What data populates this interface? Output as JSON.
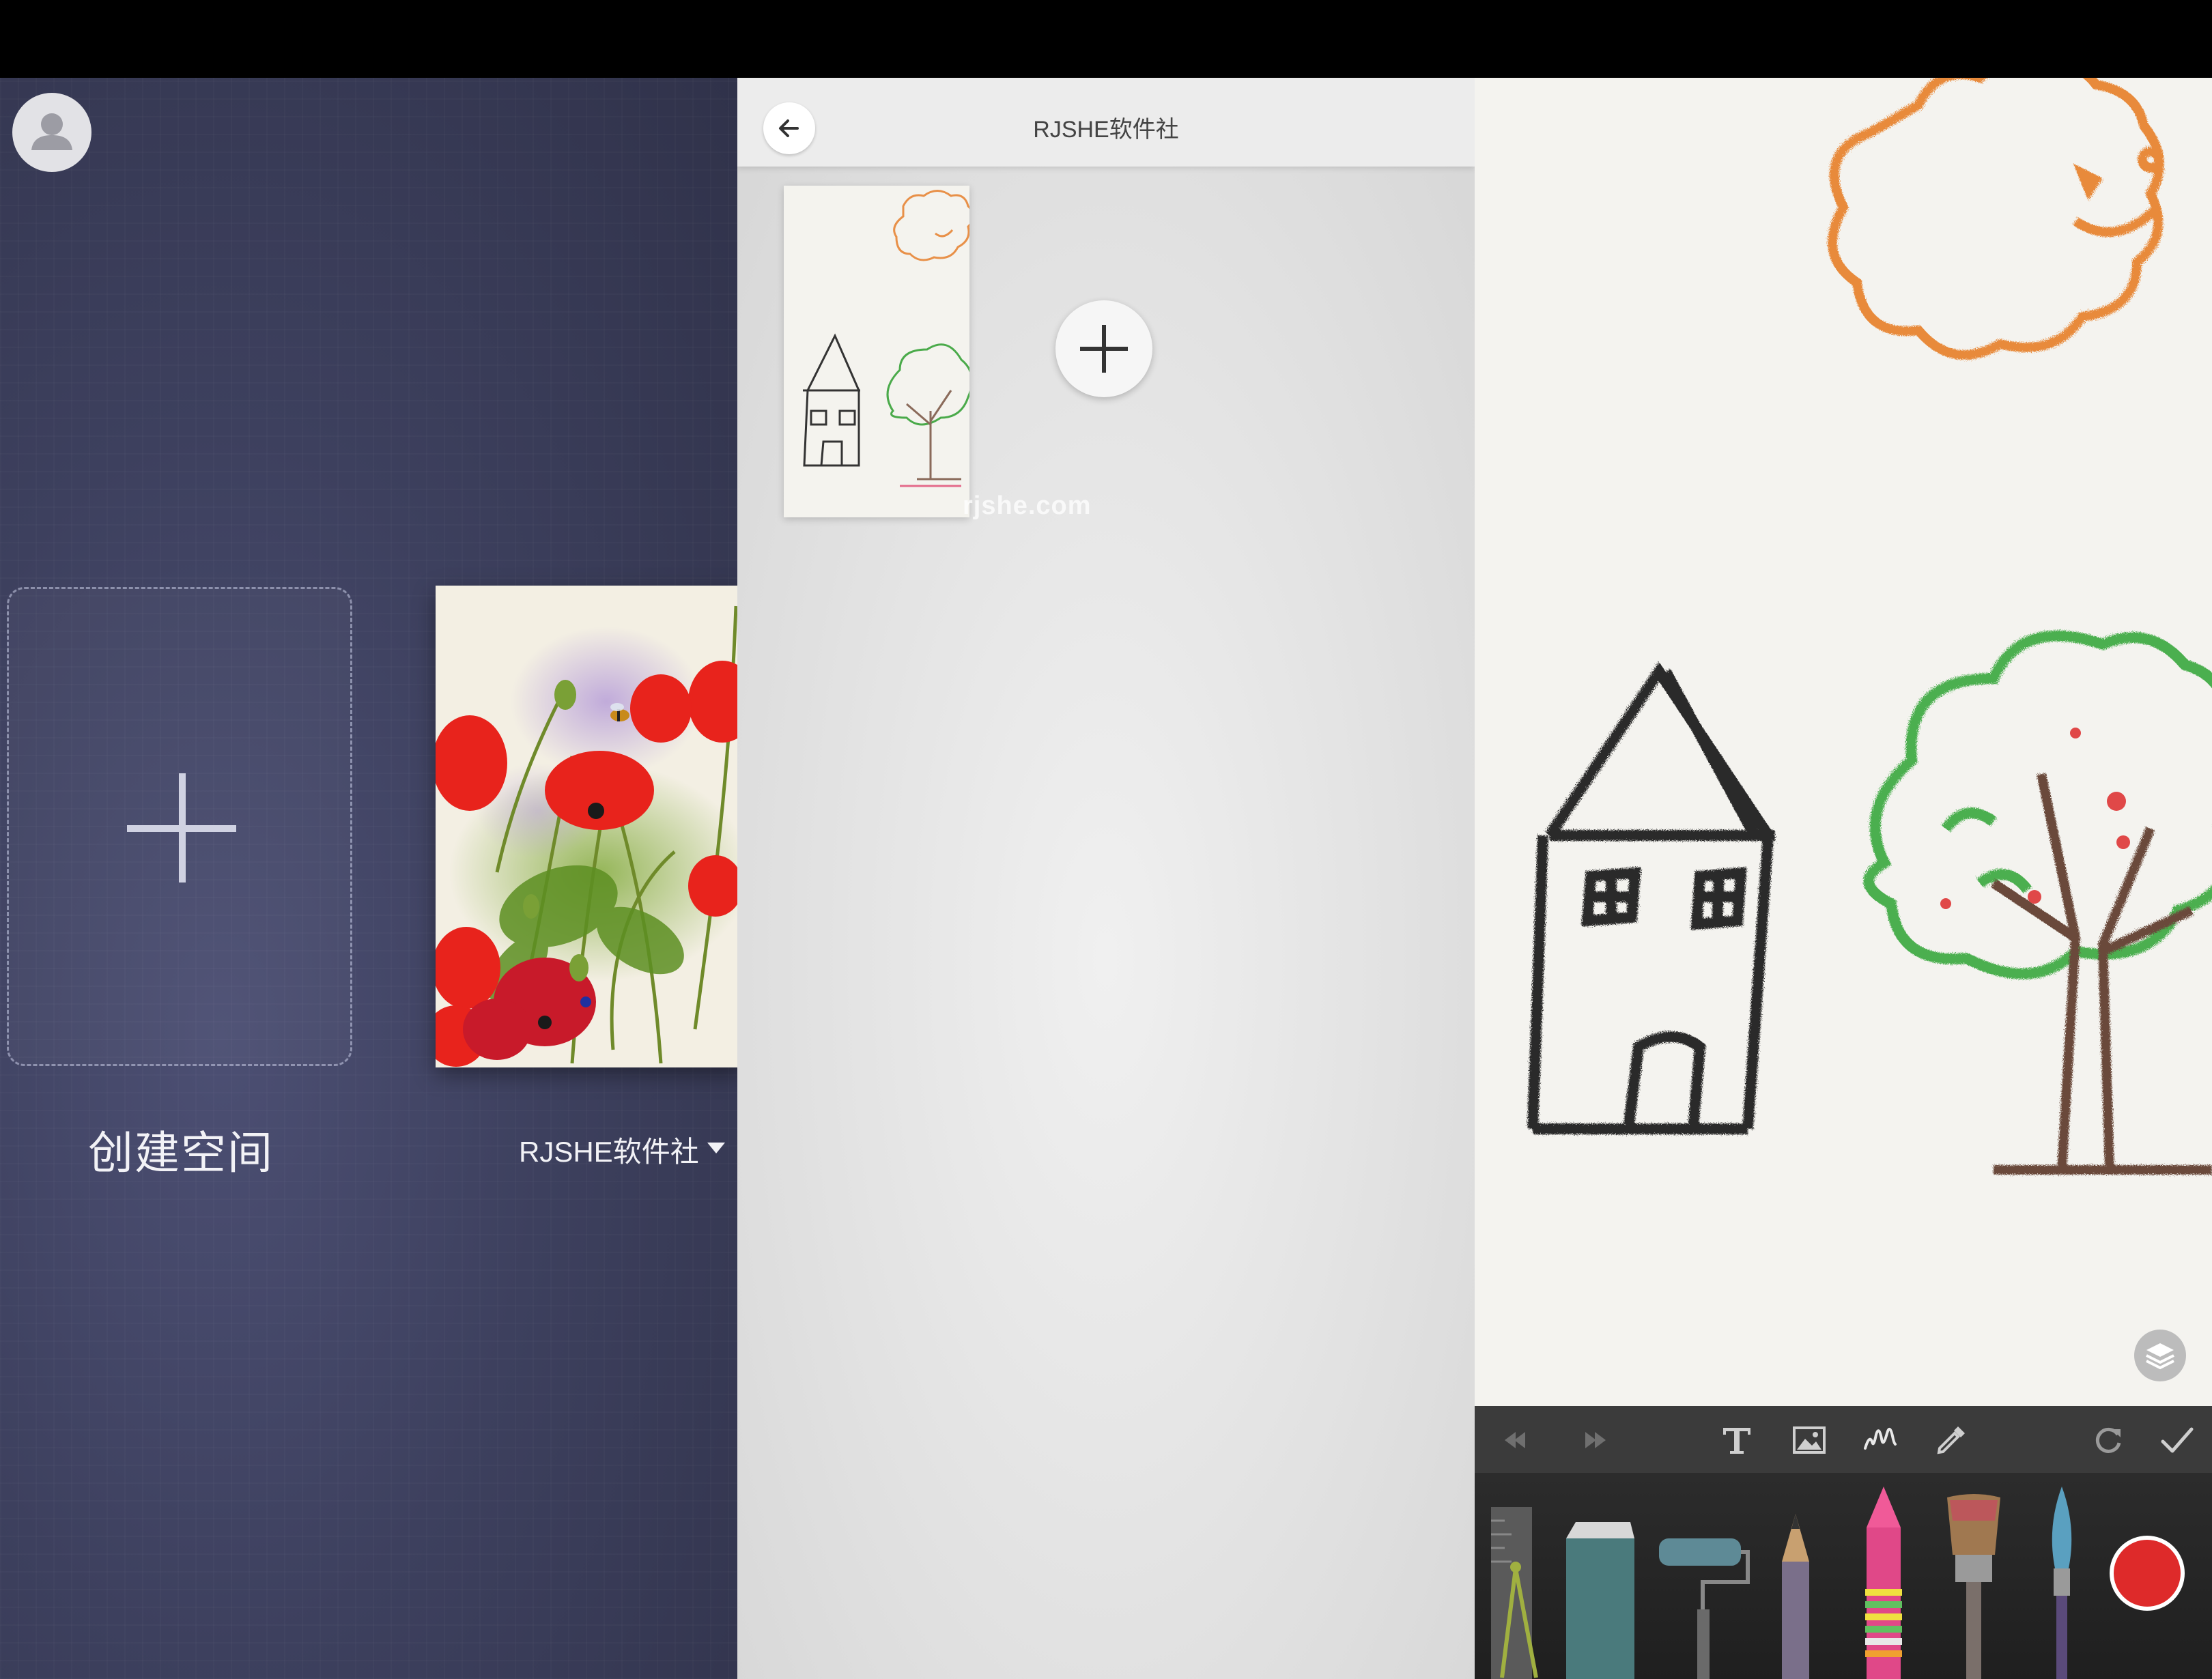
{
  "statusbar": {},
  "spaces_panel": {
    "create_label": "创建空间",
    "space": {
      "label": "RJSHE软件社",
      "dropdown_icon": "caret-down-icon"
    },
    "icons": {
      "avatar": "user-icon",
      "add": "plus-icon"
    }
  },
  "gallery_panel": {
    "title": "RJSHE软件社",
    "watermark": "rjshe.com",
    "icons": {
      "back": "arrow-left-icon",
      "add": "plus-icon"
    }
  },
  "canvas_panel": {
    "toolbar": {
      "tools": [
        "undo-icon",
        "redo-icon",
        "text-icon",
        "image-icon",
        "stroke-icon",
        "eyedropper-icon",
        "rotate-icon",
        "confirm-icon"
      ]
    },
    "brushes": [
      "ruler-compass",
      "eraser",
      "paint-roller",
      "pencil",
      "crayon",
      "flat-brush",
      "round-brush"
    ],
    "current_color": "#de2a2a"
  },
  "colors": {
    "panel1_bg": "#3d405e",
    "panel2_bg": "#e2e2e2",
    "canvas_bg": "#f4f3ef",
    "toolbar_bg": "#3b3b3b",
    "accent_red": "#de2a2a"
  }
}
